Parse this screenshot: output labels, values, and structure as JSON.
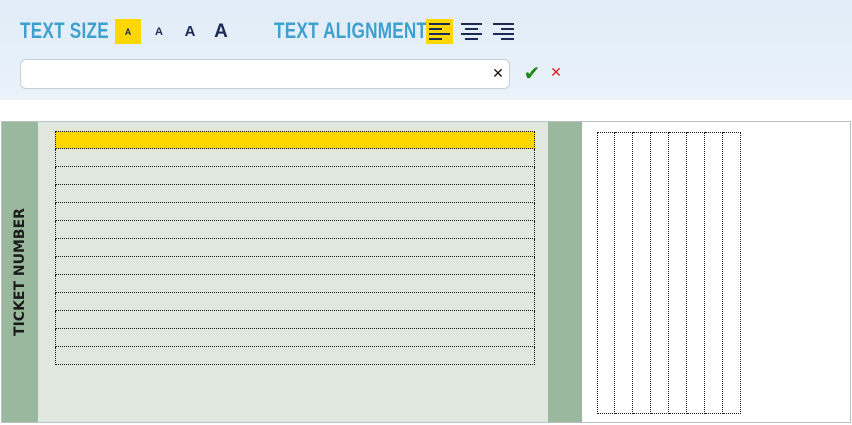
{
  "toolbar": {
    "text_size_label": "TEXT SIZE",
    "text_alignment_label": "TEXT ALIGNMENT",
    "size_options": [
      {
        "label": "A",
        "selected": true
      },
      {
        "label": "A",
        "selected": false
      },
      {
        "label": "A",
        "selected": false
      },
      {
        "label": "A",
        "selected": false
      }
    ],
    "align_options": [
      {
        "name": "align-left",
        "selected": true
      },
      {
        "name": "align-center",
        "selected": false
      },
      {
        "name": "align-right",
        "selected": false
      }
    ],
    "input_value": "",
    "input_placeholder": "",
    "clear_glyph": "✕",
    "ok_glyph": "✔",
    "cancel_glyph": "✕"
  },
  "ticket": {
    "stub_label": "TICKET NUMBER",
    "line_count": 13,
    "active_line": 0,
    "column_count": 8
  },
  "colors": {
    "accent_label": "#3ea0cf",
    "highlight": "#ffd700",
    "stub": "#9ab89e",
    "panel": "#dfe7df",
    "ok": "#1a8a1a",
    "cancel": "#e02020"
  }
}
